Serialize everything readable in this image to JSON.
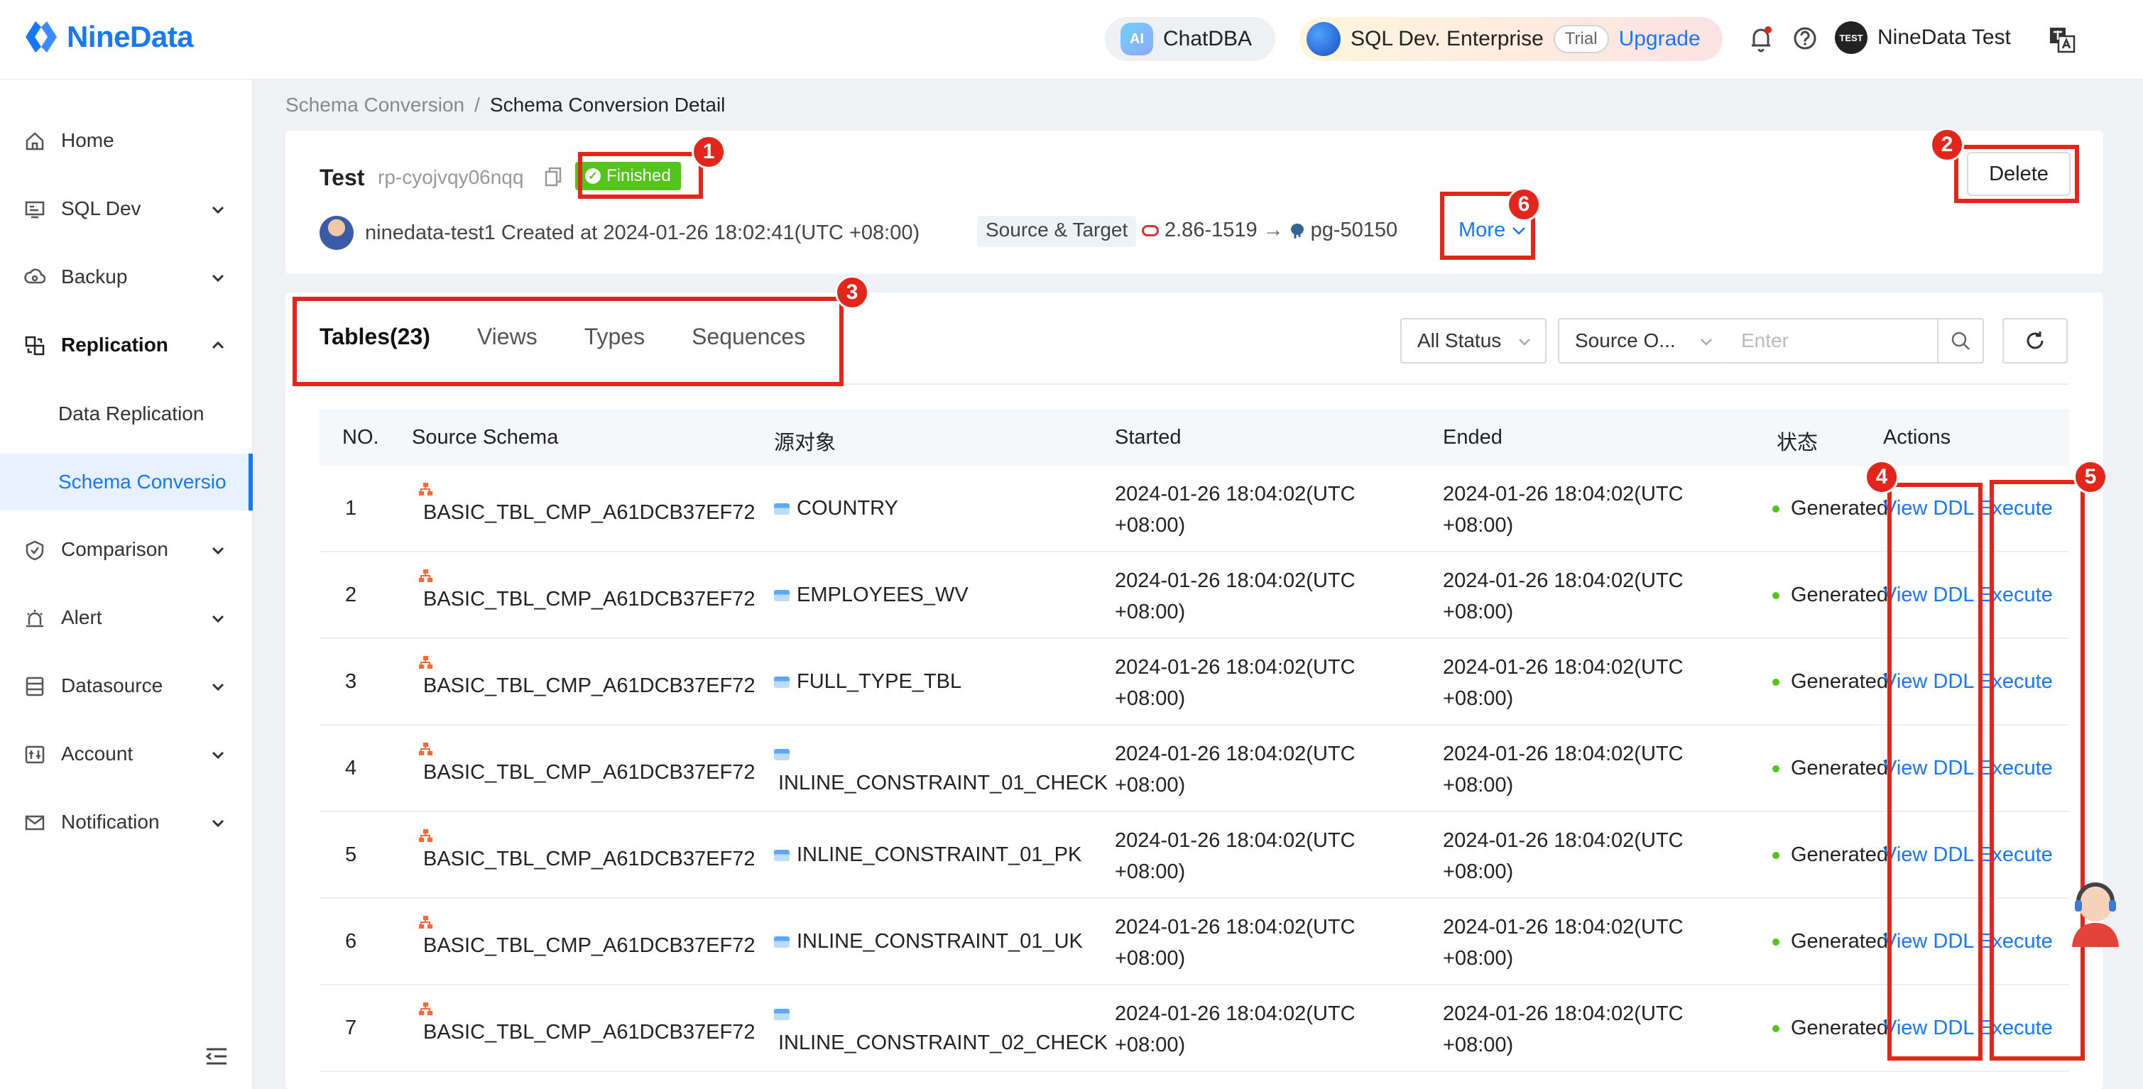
{
  "app": {
    "logo_text": "NineData",
    "brand_color": "#1677ff"
  },
  "topbar": {
    "chatdba_badge": "AI",
    "chatdba_label": "ChatDBA",
    "edition_label": "SQL Dev. Enterprise",
    "trial_label": "Trial",
    "upgrade_label": "Upgrade",
    "user_badge": "TEST",
    "user_name": "NineData Test"
  },
  "sidebar": {
    "items": [
      {
        "label": "Home",
        "icon": "home-icon"
      },
      {
        "label": "SQL Dev",
        "icon": "sql-dev-icon"
      },
      {
        "label": "Backup",
        "icon": "backup-icon"
      },
      {
        "label": "Replication",
        "icon": "replication-icon"
      },
      {
        "label": "Comparison",
        "icon": "comparison-icon"
      },
      {
        "label": "Alert",
        "icon": "alert-icon"
      },
      {
        "label": "Datasource",
        "icon": "datasource-icon"
      },
      {
        "label": "Account",
        "icon": "account-icon"
      },
      {
        "label": "Notification",
        "icon": "notification-icon"
      }
    ],
    "sub_items": [
      {
        "label": "Data Replication"
      },
      {
        "label": "Schema Conversio"
      }
    ]
  },
  "breadcrumb": {
    "parent": "Schema Conversion",
    "separator": "/",
    "current": "Schema Conversion Detail"
  },
  "job": {
    "name": "Test",
    "id": "rp-cyojvqy06nqq",
    "status": "Finished",
    "creator": "ninedata-test1",
    "created_text": "Created at 2024-01-26 18:02:41(UTC +08:00)",
    "source_target_label": "Source & Target",
    "source": "2.86-1519",
    "arrow": "→",
    "target": "pg-50150",
    "more_label": "More",
    "delete_label": "Delete"
  },
  "tabs": [
    {
      "label": "Tables(23)",
      "active": true
    },
    {
      "label": "Views",
      "active": false
    },
    {
      "label": "Types",
      "active": false
    },
    {
      "label": "Sequences",
      "active": false
    }
  ],
  "filters": {
    "status_value": "All Status",
    "source_value": "Source O...",
    "search_placeholder": "Enter"
  },
  "table": {
    "headers": [
      "NO.",
      "Source Schema",
      "源对象",
      "Started",
      "Ended",
      "状态",
      "Actions"
    ],
    "rows": [
      {
        "no": "1",
        "schema": "BASIC_TBL_CMP_A61DCB37EF72",
        "object": "COUNTRY",
        "started": "2024-01-26 18:04:02(UTC +08:00)",
        "ended": "2024-01-26 18:04:02(UTC +08:00)",
        "status": "Generated",
        "view_ddl": "View DDL",
        "execute": "Execute"
      },
      {
        "no": "2",
        "schema": "BASIC_TBL_CMP_A61DCB37EF72",
        "object": "EMPLOYEES_WV",
        "started": "2024-01-26 18:04:02(UTC +08:00)",
        "ended": "2024-01-26 18:04:02(UTC +08:00)",
        "status": "Generated",
        "view_ddl": "View DDL",
        "execute": "Execute"
      },
      {
        "no": "3",
        "schema": "BASIC_TBL_CMP_A61DCB37EF72",
        "object": "FULL_TYPE_TBL",
        "started": "2024-01-26 18:04:02(UTC +08:00)",
        "ended": "2024-01-26 18:04:02(UTC +08:00)",
        "status": "Generated",
        "view_ddl": "View DDL",
        "execute": "Execute"
      },
      {
        "no": "4",
        "schema": "BASIC_TBL_CMP_A61DCB37EF72",
        "object": "INLINE_CONSTRAINT_01_CHECK",
        "started": "2024-01-26 18:04:02(UTC +08:00)",
        "ended": "2024-01-26 18:04:02(UTC +08:00)",
        "status": "Generated",
        "view_ddl": "View DDL",
        "execute": "Execute"
      },
      {
        "no": "5",
        "schema": "BASIC_TBL_CMP_A61DCB37EF72",
        "object": "INLINE_CONSTRAINT_01_PK",
        "started": "2024-01-26 18:04:02(UTC +08:00)",
        "ended": "2024-01-26 18:04:02(UTC +08:00)",
        "status": "Generated",
        "view_ddl": "View DDL",
        "execute": "Execute"
      },
      {
        "no": "6",
        "schema": "BASIC_TBL_CMP_A61DCB37EF72",
        "object": "INLINE_CONSTRAINT_01_UK",
        "started": "2024-01-26 18:04:02(UTC +08:00)",
        "ended": "2024-01-26 18:04:02(UTC +08:00)",
        "status": "Generated",
        "view_ddl": "View DDL",
        "execute": "Execute"
      },
      {
        "no": "7",
        "schema": "BASIC_TBL_CMP_A61DCB37EF72",
        "object": "INLINE_CONSTRAINT_02_CHECK",
        "started": "2024-01-26 18:04:02(UTC +08:00)",
        "ended": "2024-01-26 18:04:02(UTC +08:00)",
        "status": "Generated",
        "view_ddl": "View DDL",
        "execute": "Execute"
      }
    ]
  },
  "annotations": [
    "1",
    "2",
    "3",
    "4",
    "5",
    "6"
  ],
  "colors": {
    "annotation": "#e3261c",
    "success": "#52c41a",
    "link": "#1677ff"
  }
}
